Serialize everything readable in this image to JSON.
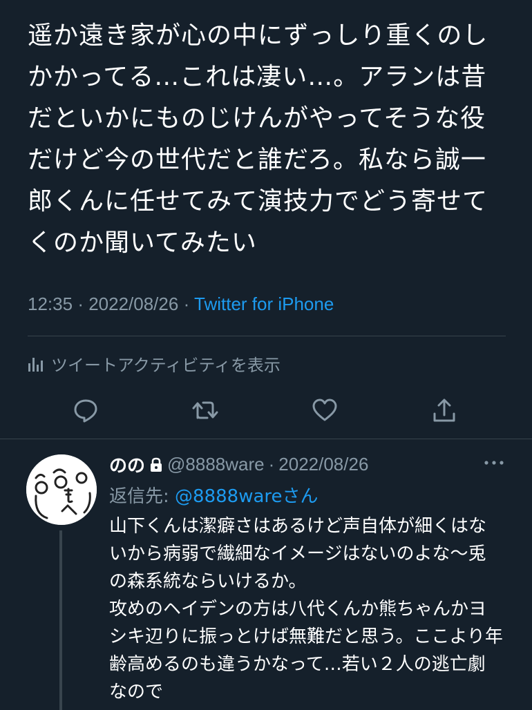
{
  "tweet": {
    "text": "遥か遠き家が心の中にずっしり重くのしかかってる…これは凄い…。アランは昔だといかにものじけんがやってそうな役だけど今の世代だと誰だろ。私なら誠一郎くんに任せてみて演技力でどう寄せてくのか聞いてみたい",
    "time": "12:35",
    "date": "2022/08/26",
    "source": "Twitter for iPhone",
    "activity_label": "ツイートアクティビティを表示"
  },
  "reply": {
    "name": "のの",
    "handle": "@8888ware",
    "date": "2022/08/26",
    "replying_prefix": "返信先:",
    "replying_handle": "@8888ware",
    "replying_suffix": "さん",
    "text": "山下くんは潔癖さはあるけど声自体が細くはないから病弱で繊細なイメージはないのよな〜兎の森系統ならいけるか。\n攻めのヘイデンの方は八代くんか熊ちゃんかヨシキ辺りに振っとけば無難だと思う。ここより年齢高めるのも違うかなって…若い２人の逃亡劇なので"
  },
  "icons": {
    "activity": "bar-chart-icon",
    "reply": "comment-icon",
    "retweet": "retweet-icon",
    "like": "heart-icon",
    "share": "share-icon",
    "lock": "lock-icon",
    "more": "more-icon"
  },
  "colors": {
    "background": "#15202b",
    "accent": "#1d9bf0",
    "secondary_text": "#8899a6",
    "divider": "#38444d"
  }
}
